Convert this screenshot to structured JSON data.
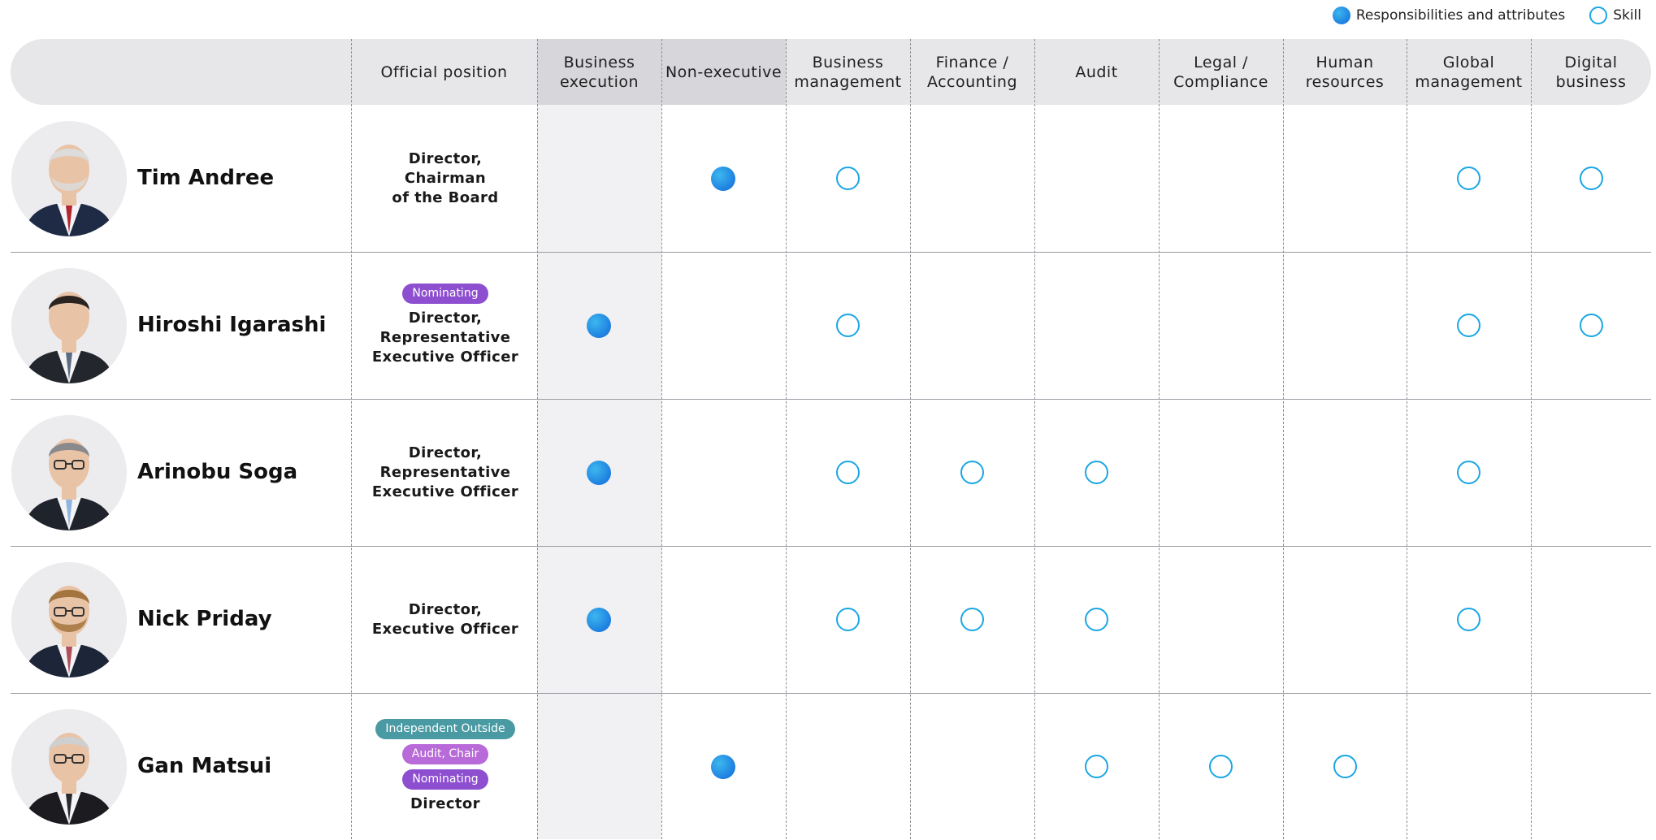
{
  "legend": {
    "responsibilities_label": "Responsibilities and attributes",
    "skill_label": "Skill"
  },
  "columns": [
    {
      "key": "position",
      "label": "Official position"
    },
    {
      "key": "business_execution",
      "label": "Business\nexecution"
    },
    {
      "key": "non_executive",
      "label": "Non-executive"
    },
    {
      "key": "business_management",
      "label": "Business\nmanagement"
    },
    {
      "key": "finance_accounting",
      "label": "Finance /\nAccounting"
    },
    {
      "key": "audit",
      "label": "Audit"
    },
    {
      "key": "legal_compliance",
      "label": "Legal /\nCompliance"
    },
    {
      "key": "human_resources",
      "label": "Human\nresources"
    },
    {
      "key": "global_management",
      "label": "Global\nmanagement"
    },
    {
      "key": "digital_business",
      "label": "Digital\nbusiness"
    }
  ],
  "badge_colors": {
    "Nominating": "#8d4fcf",
    "Audit, Chair": "#b86ad8",
    "Independent Outside": "#4a9aa3"
  },
  "rows": [
    {
      "name": "Tim Andree",
      "badges": [],
      "position": "Director,\nChairman\nof the Board",
      "execution": "non_executive",
      "skills": [
        "business_management",
        "global_management",
        "digital_business"
      ],
      "avatar": {
        "hair": "#dcdcdc",
        "suit": "#1f2a44",
        "tie": "#b3262f",
        "beard": true,
        "glasses": false
      }
    },
    {
      "name": "Hiroshi Igarashi",
      "badges": [
        "Nominating"
      ],
      "position": "Director,\nRepresentative\nExecutive Officer",
      "execution": "business_execution",
      "skills": [
        "business_management",
        "global_management",
        "digital_business"
      ],
      "avatar": {
        "hair": "#2a2320",
        "suit": "#23262c",
        "tie": "#5a6b82",
        "beard": false,
        "glasses": false
      }
    },
    {
      "name": "Arinobu Soga",
      "badges": [],
      "position": "Director,\nRepresentative\nExecutive Officer",
      "execution": "business_execution",
      "skills": [
        "business_management",
        "finance_accounting",
        "audit",
        "global_management"
      ],
      "avatar": {
        "hair": "#8a8a8c",
        "suit": "#1f232b",
        "tie": "#8fb6e0",
        "beard": false,
        "glasses": true
      }
    },
    {
      "name": "Nick Priday",
      "badges": [],
      "position": "Director,\nExecutive Officer",
      "execution": "business_execution",
      "skills": [
        "business_management",
        "finance_accounting",
        "audit",
        "global_management"
      ],
      "avatar": {
        "hair": "#a3743e",
        "suit": "#1d2638",
        "tie": "#b0505c",
        "beard": true,
        "glasses": true
      }
    },
    {
      "name": "Gan Matsui",
      "badges": [
        "Independent Outside",
        "Audit, Chair",
        "Nominating"
      ],
      "position": "Director",
      "execution": "non_executive",
      "skills": [
        "audit",
        "legal_compliance",
        "human_resources"
      ],
      "avatar": {
        "hair": "#cfcfcf",
        "suit": "#1c1c20",
        "tie": "#2a2a2e",
        "beard": false,
        "glasses": true
      }
    }
  ]
}
